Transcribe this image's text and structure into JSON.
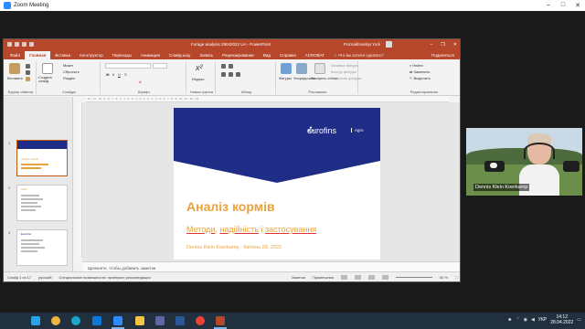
{
  "zoom": {
    "title": "Zoom Meeting"
  },
  "ppt": {
    "doc_title": "Forage analysis 28042022 UA  -  PowerPoint",
    "user": "Poznakhovskyi Yurii",
    "share": "Поделиться",
    "tabs": [
      "Файл",
      "Главная",
      "Вставка",
      "Конструктор",
      "Переходы",
      "Анимация",
      "Слайд-шоу",
      "Запись",
      "Рецензирование",
      "Вид",
      "Справка",
      "ACROBAT"
    ],
    "active_tab": "Главная",
    "search_placeholder": "Что вы хотите сделать?",
    "ribbon": {
      "groups": [
        "Буфер обмена",
        "Слайды",
        "Шрифт",
        "Абзац",
        "Рисование",
        "Редактирование"
      ],
      "paste": "Вставить",
      "create_slide": "Создать слайд",
      "layout": "Макет",
      "reset": "Сбросить",
      "section": "Раздел",
      "new_group": "Новая группа",
      "index": "Индекс",
      "shapes": "Фигуры",
      "arrange": "Упорядочить",
      "quick_styles": "Экспресс-стили",
      "shape_fill": "Заливка фигуры",
      "shape_outline": "Контур фигуры",
      "shape_effects": "Эффекты фигуры",
      "find": "Найти",
      "replace": "Заменить",
      "select": "Выделить"
    },
    "thumbnails": [
      {
        "num": "1",
        "label": "Аналіз кормів"
      },
      {
        "num": "2",
        "label": "Зміст"
      },
      {
        "num": "3",
        "label": "Eurofins"
      },
      {
        "num": "4",
        "label": "Eurofins"
      }
    ],
    "slide": {
      "logo": "eurofins",
      "logo_sub": "Agro",
      "title": "Аналіз кормів",
      "subtitle_parts": [
        "Методи",
        ", ",
        "надійність",
        " і ",
        "застосування"
      ],
      "author": "Dennis Klein Koerkamp - Квітень 28, 2022"
    },
    "notes_placeholder": "Щелкните, чтобы добавить заметки",
    "status": {
      "slide_of": "Слайд 1 из 17",
      "language": "русский",
      "accessibility": "Специальные возможности: проверьте рекомендации",
      "notes_btn": "Заметки",
      "comments_btn": "Примечания",
      "zoom": "60 %"
    }
  },
  "video": {
    "name": "Dennis Klein Koerkamp"
  },
  "taskbar": {
    "lang": "УКР",
    "time": "14:12",
    "date": "28.04.2022"
  },
  "colors": {
    "ppt_accent": "#b7472a",
    "slide_navy": "#1f2d87",
    "slide_orange": "#e8a33d",
    "taskbar": "#20303f"
  }
}
